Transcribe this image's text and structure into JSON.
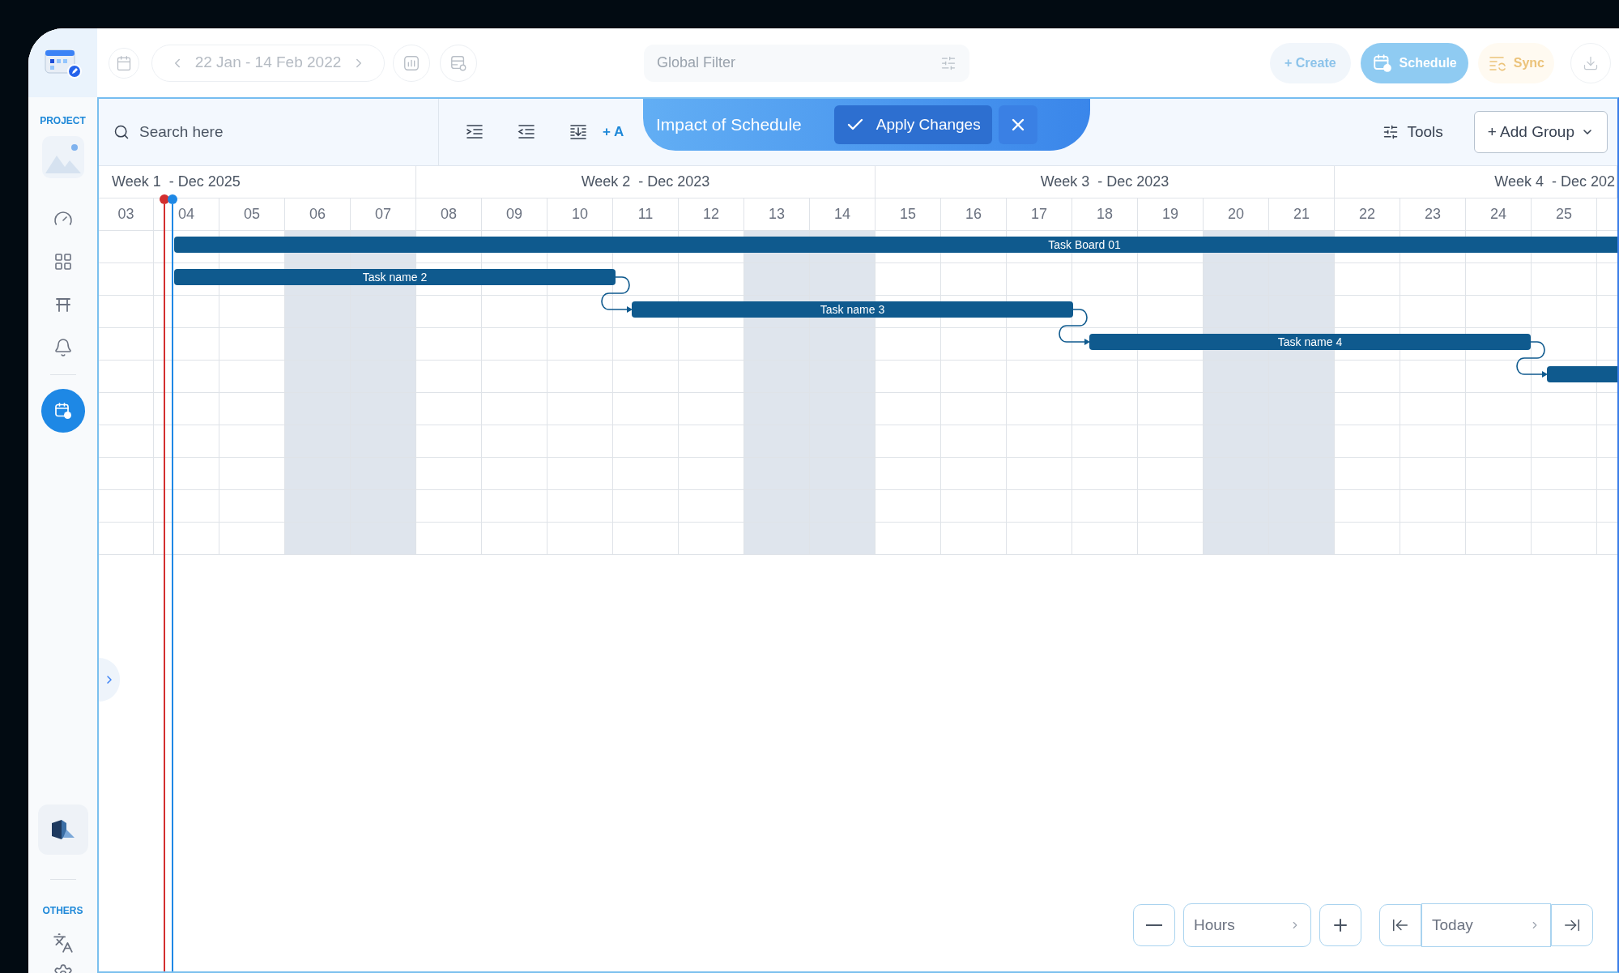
{
  "top_bar": {
    "date_range": "22 Jan - 14 Feb 2022",
    "filter": {
      "placeholder": "Global Filter"
    },
    "buttons": [
      {
        "label": "+ Create",
        "kind": "create"
      },
      {
        "label": "Schedule",
        "kind": "schedule"
      },
      {
        "label": "Sync",
        "kind": "sync"
      }
    ]
  },
  "sidebar": {
    "project_label": "PROJECT",
    "items": [
      {
        "selected": false
      },
      {
        "selected": false
      },
      {
        "selected": false
      },
      {
        "selected": false
      },
      {
        "selected": true
      }
    ],
    "others_label": "OTHERS"
  },
  "toolbar": {
    "search": {
      "placeholder": "Search here"
    },
    "add_text": "+ A",
    "tools": "Tools",
    "add_group": "+ Add Group"
  },
  "banner": {
    "title": "Impact of Schedule",
    "apply": "Apply Changes"
  },
  "timeline": {
    "weeks": [
      "Week 1  - Dec 2025",
      "Week 2  - Dec 2023",
      "Week 3  - Dec 2023",
      "Week 4  - Dec 202"
    ],
    "days": [
      {
        "label": "03",
        "weekend": false
      },
      {
        "label": "04",
        "weekend": false
      },
      {
        "label": "05",
        "weekend": false
      },
      {
        "label": "06",
        "weekend": true
      },
      {
        "label": "07",
        "weekend": true
      },
      {
        "label": "08",
        "weekend": false
      },
      {
        "label": "09",
        "weekend": false
      },
      {
        "label": "10",
        "weekend": false
      },
      {
        "label": "11",
        "weekend": false
      },
      {
        "label": "12",
        "weekend": false
      },
      {
        "label": "13",
        "weekend": true
      },
      {
        "label": "14",
        "weekend": true
      },
      {
        "label": "15",
        "weekend": false
      },
      {
        "label": "16",
        "weekend": false
      },
      {
        "label": "17",
        "weekend": false
      },
      {
        "label": "18",
        "weekend": false
      },
      {
        "label": "19",
        "weekend": false
      },
      {
        "label": "20",
        "weekend": true
      },
      {
        "label": "21",
        "weekend": true
      },
      {
        "label": "22",
        "weekend": false
      },
      {
        "label": "23",
        "weekend": false
      },
      {
        "label": "24",
        "weekend": false
      },
      {
        "label": "25",
        "weekend": false
      }
    ],
    "rows": [
      {
        "kind": "group",
        "label": "Task Board 01"
      },
      {
        "kind": "task",
        "label": "Task name 2"
      },
      {
        "kind": "task",
        "label": "Task name 3"
      },
      {
        "kind": "task",
        "label": "Task name 4"
      },
      {
        "kind": "task"
      }
    ]
  },
  "zoom": {
    "unit": "Hours"
  },
  "navigation": {
    "label": "Today"
  }
}
